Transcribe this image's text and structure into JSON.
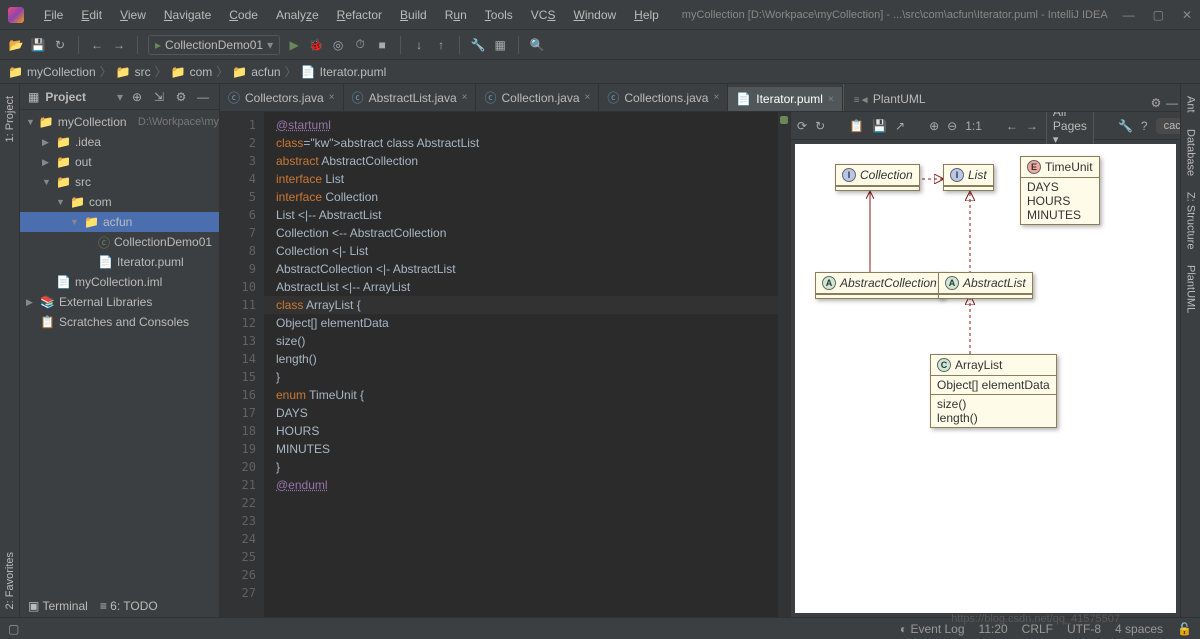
{
  "window": {
    "title": "myCollection [D:\\Workpace\\myCollection] - ...\\src\\com\\acfun\\Iterator.puml - IntelliJ IDEA"
  },
  "menu": [
    "File",
    "Edit",
    "View",
    "Navigate",
    "Code",
    "Analyze",
    "Refactor",
    "Build",
    "Run",
    "Tools",
    "VCS",
    "Window",
    "Help"
  ],
  "run_config": "CollectionDemo01",
  "breadcrumb": [
    "myCollection",
    "src",
    "com",
    "acfun",
    "Iterator.puml"
  ],
  "project_panel": {
    "title": "Project"
  },
  "tree": {
    "root": {
      "name": "myCollection",
      "path": "D:\\Workpace\\myColle"
    },
    "idea": ".idea",
    "out": "out",
    "src": "src",
    "com": "com",
    "acfun": "acfun",
    "file1": "CollectionDemo01",
    "file2": "Iterator.puml",
    "iml": "myCollection.iml",
    "external": "External Libraries",
    "scratches": "Scratches and Consoles"
  },
  "tabs": [
    {
      "label": "Collectors.java"
    },
    {
      "label": "AbstractList.java"
    },
    {
      "label": "Collection.java"
    },
    {
      "label": "Collections.java"
    },
    {
      "label": "Iterator.puml",
      "active": true
    }
  ],
  "tool_label": "PlantUML",
  "code_lines": [
    {
      "n": 1,
      "t": "@startuml",
      "cls": "tag"
    },
    {
      "n": 2,
      "t": ""
    },
    {
      "n": 3,
      "t": "abstract class AbstractList",
      "kw": [
        "abstract",
        "class"
      ]
    },
    {
      "n": 4,
      "t": "abstract AbstractCollection",
      "kw": [
        "abstract"
      ]
    },
    {
      "n": 5,
      "t": "interface List",
      "kw": [
        "interface"
      ]
    },
    {
      "n": 6,
      "t": "interface Collection",
      "kw": [
        "interface"
      ]
    },
    {
      "n": 7,
      "t": ""
    },
    {
      "n": 8,
      "t": "List <|-- AbstractList"
    },
    {
      "n": 9,
      "t": "Collection <-- AbstractCollection"
    },
    {
      "n": 10,
      "t": ""
    },
    {
      "n": 11,
      "t": "Collection <|- List",
      "hl": true
    },
    {
      "n": 12,
      "t": "AbstractCollection <|- AbstractList"
    },
    {
      "n": 13,
      "t": "AbstractList <|-- ArrayList"
    },
    {
      "n": 14,
      "t": ""
    },
    {
      "n": 15,
      "t": "class ArrayList {",
      "kw": [
        "class"
      ]
    },
    {
      "n": 16,
      "t": "Object[] elementData"
    },
    {
      "n": 17,
      "t": "size()"
    },
    {
      "n": 18,
      "t": "length()"
    },
    {
      "n": 19,
      "t": "}"
    },
    {
      "n": 20,
      "t": ""
    },
    {
      "n": 21,
      "t": "enum TimeUnit {",
      "kw": [
        "enum"
      ]
    },
    {
      "n": 22,
      "t": "DAYS"
    },
    {
      "n": 23,
      "t": "HOURS"
    },
    {
      "n": 24,
      "t": "MINUTES"
    },
    {
      "n": 25,
      "t": "}"
    },
    {
      "n": 26,
      "t": ""
    },
    {
      "n": 27,
      "t": "@enduml",
      "cls": "tag"
    }
  ],
  "preview": {
    "pages": "All Pages",
    "zoom": "1:1",
    "status": "cached",
    "boxes": {
      "collection": "Collection",
      "list": "List",
      "timeunit": "TimeUnit",
      "timeunit_body": [
        "DAYS",
        "HOURS",
        "MINUTES"
      ],
      "abstractcollection": "AbstractCollection",
      "abstractlist": "AbstractList",
      "arraylist": "ArrayList",
      "arraylist_body": [
        "Object[] elementData",
        "size()",
        "length()"
      ]
    }
  },
  "status": {
    "terminal": "Terminal",
    "todo": "TODO",
    "event_log": "Event Log",
    "cursor": "11:20",
    "encoding": "CRLF",
    "charset": "UTF-8",
    "indent": "4 spaces"
  },
  "left_tabs": [
    "1: Project",
    "2: Favorites"
  ],
  "right_tabs": [
    "Ant",
    "Database",
    "Z: Structure",
    "PlantUML"
  ],
  "watermark": "https://blog.csdn.net/qq_41575507"
}
